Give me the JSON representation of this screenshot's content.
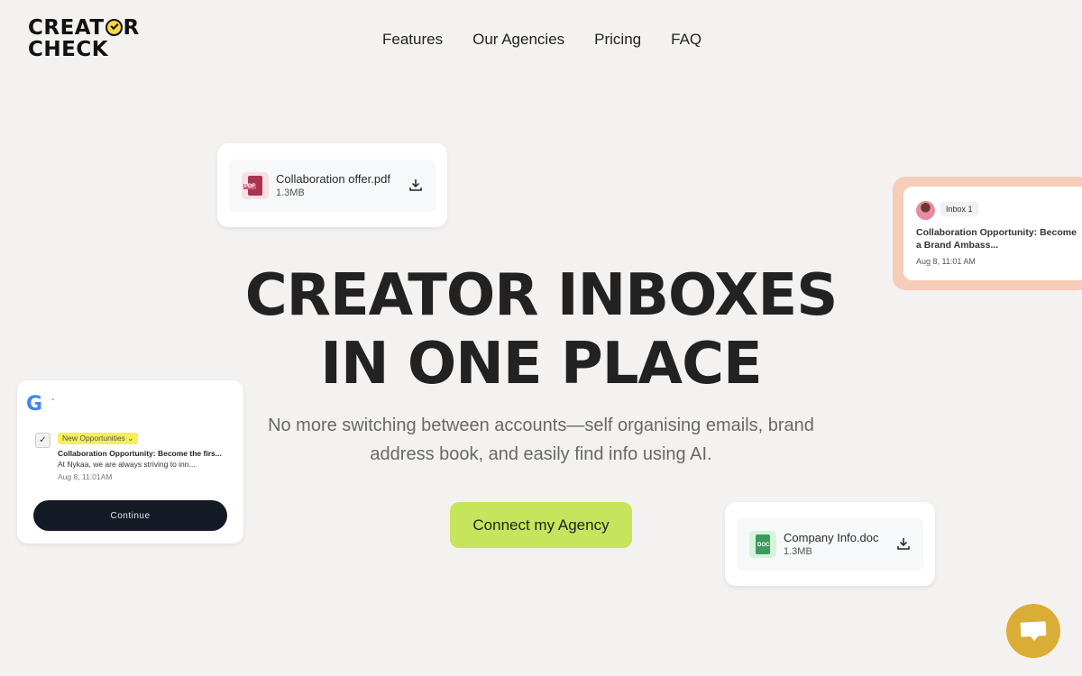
{
  "logo": {
    "line1_a": "CREAT",
    "line1_b": "R",
    "line2": "CHECK"
  },
  "nav": {
    "items": [
      {
        "label": "Features"
      },
      {
        "label": "Our Agencies"
      },
      {
        "label": "Pricing"
      },
      {
        "label": "FAQ"
      }
    ]
  },
  "hero": {
    "title_line1": "CREATOR INBOXES",
    "title_line2": "IN ONE PLACE",
    "subtitle": "No more switching between accounts—self organising emails, brand address book, and easily find info using AI.",
    "cta_label": "Connect my Agency"
  },
  "file_cards": [
    {
      "name": "Collaboration offer.pdf",
      "size": "1.3MB",
      "type_label": "PDF",
      "color": "#a8354f"
    },
    {
      "name": "Company Info.doc",
      "size": "1.3MB",
      "type_label": "DOC",
      "color": "#3d9a5c"
    }
  ],
  "inbox_card": {
    "badge": "Inbox 1",
    "title": "Collaboration Opportunity: Become a Brand Ambass...",
    "date": "Aug 8, 11:01 AM"
  },
  "gmail_card": {
    "logo": "G",
    "account": "-",
    "check": "✓",
    "label": "New Opportunities ⌄",
    "title": "Collaboration Opportunity: Become the firs...",
    "preview": "At Nykaa, we are always striving to inn...",
    "date": "Aug 8, 11:01AM",
    "continue_label": "Continue"
  },
  "colors": {
    "accent": "#c7e45d",
    "chat": "#d9ad36",
    "background": "#f4f2f1"
  }
}
